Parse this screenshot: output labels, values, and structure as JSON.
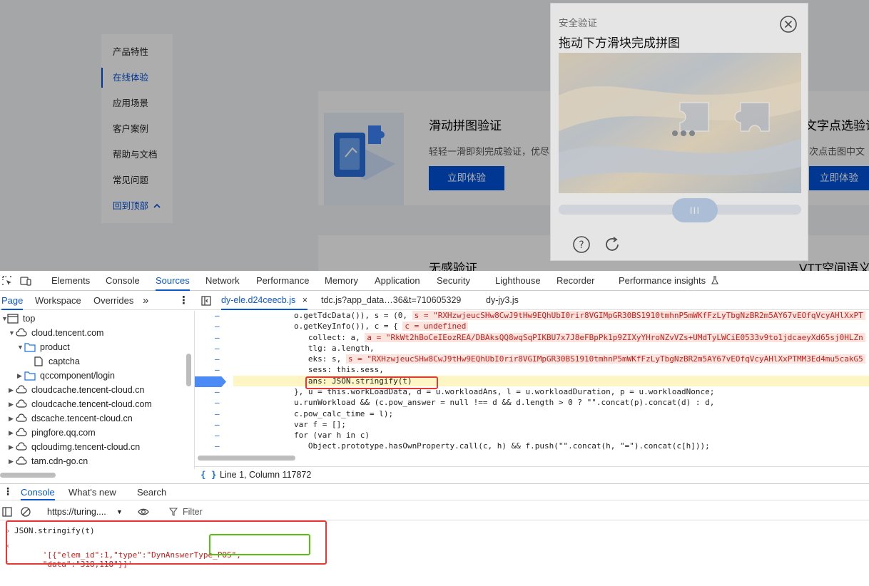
{
  "webpage": {
    "nav_items": [
      "产品特性",
      "在线体验",
      "应用场景",
      "客户案例",
      "帮助与文档",
      "常见问题",
      "回到顶部"
    ],
    "cards": [
      {
        "title": "滑动拼图验证",
        "desc": "轻轻一滑即刻完成验证，优尽",
        "button": "立即体验"
      },
      {
        "title": "文字点选验证",
        "desc": "次点击图中文",
        "button": "立即体验"
      },
      {
        "title": "无感验证",
        "desc": "",
        "button": ""
      },
      {
        "title": "VTT空间语义",
        "desc": "",
        "button": ""
      }
    ]
  },
  "captcha": {
    "header": "安全验证",
    "title": "拖动下方滑块完成拼图",
    "slider_handle": "III",
    "colors": {
      "accent": "#0052d9",
      "slider": "#c0d4ee"
    }
  },
  "devtools": {
    "main_tabs": [
      "Elements",
      "Console",
      "Sources",
      "Network",
      "Performance",
      "Memory",
      "Application",
      "Security",
      "Lighthouse",
      "Recorder",
      "Performance insights"
    ],
    "active_main_tab": "Sources",
    "nav_tabs": [
      "Page",
      "Workspace",
      "Overrides",
      "»"
    ],
    "file_tree": [
      {
        "label": "top",
        "icon": "frame-icon"
      },
      {
        "label": "cloud.tencent.com",
        "icon": "cloud-icon"
      },
      {
        "label": "product",
        "icon": "folder-icon"
      },
      {
        "label": "captcha",
        "icon": "file-icon"
      },
      {
        "label": "qccomponent/login",
        "icon": "folder-icon"
      },
      {
        "label": "cloudcache.tencent-cloud.cn",
        "icon": "cloud-icon"
      },
      {
        "label": "cloudcache.tencent-cloud.com",
        "icon": "cloud-icon"
      },
      {
        "label": "dscache.tencent-cloud.cn",
        "icon": "cloud-icon"
      },
      {
        "label": "pingfore.qq.com",
        "icon": "cloud-icon"
      },
      {
        "label": "qcloudimg.tencent-cloud.cn",
        "icon": "cloud-icon"
      },
      {
        "label": "tam.cdn-go.cn",
        "icon": "cloud-icon"
      }
    ],
    "file_tabs": [
      "dy-ele.d24ceecb.js",
      "tdc.js?app_data…36&t=710605329",
      "dy-jy3.js"
    ],
    "code_lines": [
      {
        "text": "o.getTdcData()), s = (0, ",
        "inline": "s = \"RXHzwjeucSHw8CwJ9tHw9EQhUbI0rir8VGIMpGR30BS1910tmhnP5mWKfFzLyTbgNzBR2m5AY67vEOfqVcyAHlXxPT"
      },
      {
        "text": "o.getKeyInfo()), c = { ",
        "inline": "c = undefined"
      },
      {
        "text": "   collect: a, ",
        "inline": "a = \"RkWt2hBoCeIEozREA/DBAksQQ8wqSqPIKBU7x7J8eFBpPk1p9ZIXyYHroNZvVZs+UMdTyLWCiE0533v9to1jdcaeyXd65sj0HLZn"
      },
      {
        "text": "   tlg: a.length,",
        "inline": ""
      },
      {
        "text": "   eks: s, ",
        "inline": "s = \"RXHzwjeucSHw8CwJ9tHw9EQhUbI0rir8VGIMpGR30BS1910tmhnP5mWKfFzLyTbgNzBR2m5AY67vEOfqVcyAHlXxPTMM3Ed4mu5cakG5"
      },
      {
        "text": "   sess: this.sess,",
        "inline": ""
      },
      {
        "text": "   ans: JSON.stringify(t)",
        "inline": ""
      },
      {
        "text": "}, u = this.workLoadData, d = u.workloadAns, l = u.workloadDuration, p = u.workloadNonce;",
        "inline": ""
      },
      {
        "text": "u.runWorkload && (c.pow_answer = null !== d && d.length > 0 ? \"\".concat(p).concat(d) : d,",
        "inline": ""
      },
      {
        "text": "c.pow_calc_time = l);",
        "inline": ""
      },
      {
        "text": "var f = [];",
        "inline": ""
      },
      {
        "text": "for (var h in c)",
        "inline": ""
      },
      {
        "text": "   Object.prototype.hasOwnProperty.call(c, h) && f.push(\"\".concat(h, \"=\").concat(c[h]));",
        "inline": ""
      }
    ],
    "status": "Line 1, Column 117872",
    "drawer_tabs": [
      "Console",
      "What's new",
      "Search"
    ],
    "context": "https://turing....",
    "filter_placeholder": "Filter",
    "console_input": "JSON.stringify(t)",
    "console_output_prefix": "'[{\"elem_id\":1,\"type\":\"DynAnswerType_POS\",",
    "console_output_data": "\"data\":\"318,118\"}]'"
  }
}
